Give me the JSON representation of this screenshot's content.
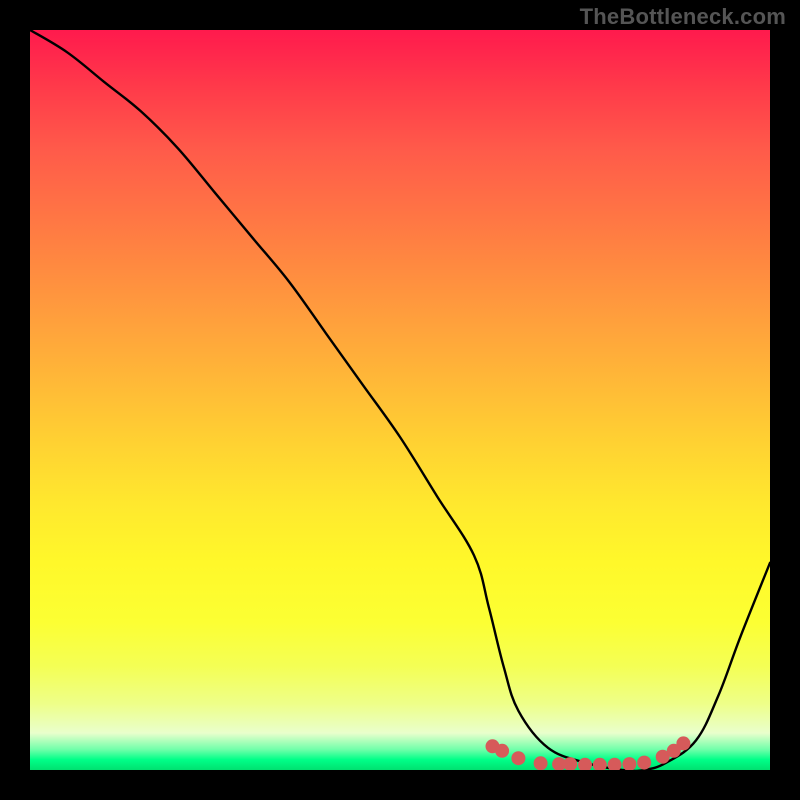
{
  "watermark": "TheBottleneck.com",
  "chart_data": {
    "type": "line",
    "title": "",
    "xlabel": "",
    "ylabel": "",
    "xlim": [
      0,
      100
    ],
    "ylim": [
      0,
      100
    ],
    "grid": false,
    "legend": false,
    "series": [
      {
        "name": "curve",
        "color": "#000000",
        "x": [
          0,
          5,
          10,
          15,
          20,
          25,
          30,
          35,
          40,
          45,
          50,
          55,
          60,
          62,
          64,
          66,
          70,
          75,
          80,
          83,
          86,
          90,
          93,
          96,
          100
        ],
        "values": [
          100,
          97,
          93,
          89,
          84,
          78,
          72,
          66,
          59,
          52,
          45,
          37,
          29,
          22,
          14,
          8,
          3,
          1,
          0,
          0,
          1,
          4,
          10,
          18,
          28
        ]
      }
    ],
    "markers": [
      {
        "x": 62.5,
        "y": 3.2
      },
      {
        "x": 63.8,
        "y": 2.6
      },
      {
        "x": 66.0,
        "y": 1.6
      },
      {
        "x": 69.0,
        "y": 0.9
      },
      {
        "x": 71.5,
        "y": 0.8
      },
      {
        "x": 73.0,
        "y": 0.8
      },
      {
        "x": 75.0,
        "y": 0.7
      },
      {
        "x": 77.0,
        "y": 0.7
      },
      {
        "x": 79.0,
        "y": 0.7
      },
      {
        "x": 81.0,
        "y": 0.8
      },
      {
        "x": 83.0,
        "y": 1.0
      },
      {
        "x": 85.5,
        "y": 1.8
      },
      {
        "x": 87.0,
        "y": 2.6
      },
      {
        "x": 88.3,
        "y": 3.6
      }
    ],
    "marker_color": "#d65a5a",
    "marker_radius": 7
  }
}
